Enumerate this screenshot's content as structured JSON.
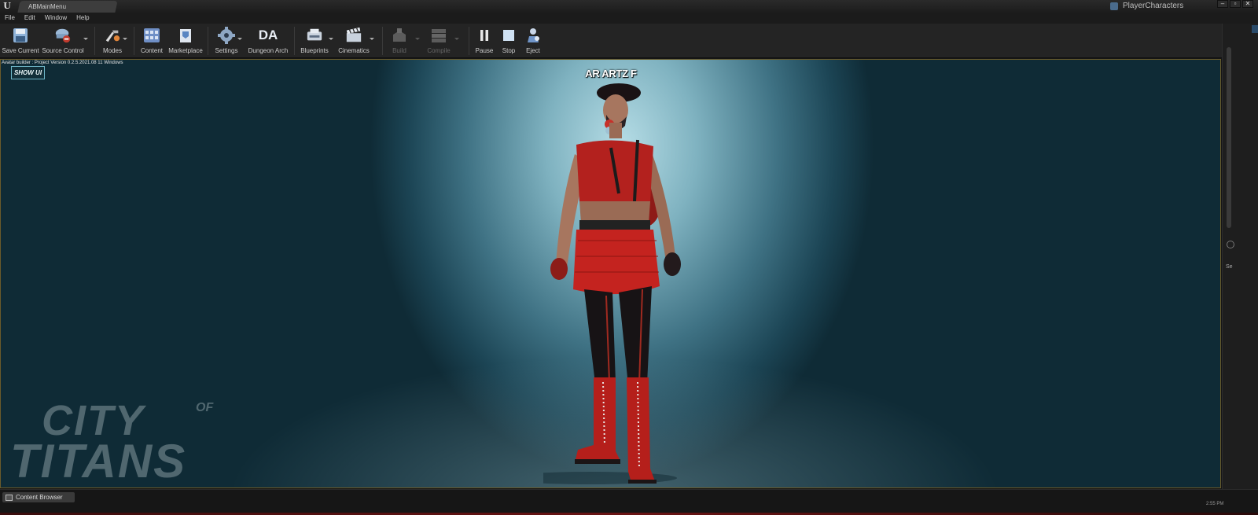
{
  "window": {
    "tab_title": "ABMainMenu",
    "project_name": "PlayerCharacters",
    "controls": [
      "–",
      "▫",
      "✕"
    ]
  },
  "menu": {
    "items": [
      "File",
      "Edit",
      "Window",
      "Help"
    ]
  },
  "toolbar": {
    "buttons": [
      {
        "label": "Save Current",
        "icon": "save-icon",
        "enabled": true
      },
      {
        "label": "Source Control",
        "icon": "source-control-icon",
        "enabled": true
      },
      {
        "label": "Modes",
        "icon": "modes-icon",
        "enabled": true
      },
      {
        "label": "Content",
        "icon": "content-icon",
        "enabled": true
      },
      {
        "label": "Marketplace",
        "icon": "marketplace-icon",
        "enabled": true
      },
      {
        "label": "Settings",
        "icon": "settings-icon",
        "enabled": true
      },
      {
        "label": "Dungeon Arch",
        "icon": "dungeon-arch-icon",
        "enabled": true
      },
      {
        "label": "Blueprints",
        "icon": "blueprints-icon",
        "enabled": true
      },
      {
        "label": "Cinematics",
        "icon": "cinematics-icon",
        "enabled": true
      },
      {
        "label": "Build",
        "icon": "build-icon",
        "enabled": false
      },
      {
        "label": "Compile",
        "icon": "compile-icon",
        "enabled": false
      },
      {
        "label": "Pause",
        "icon": "pause-icon",
        "enabled": true
      },
      {
        "label": "Stop",
        "icon": "stop-icon",
        "enabled": true
      },
      {
        "label": "Eject",
        "icon": "eject-icon",
        "enabled": true
      }
    ],
    "dungeon_arch_glyph": "DA"
  },
  "viewport": {
    "version_text": "Avatar builder : Project Version 0.2.5.2021.08 11 Windows",
    "show_ui_label": "SHOW UI",
    "character_name": "AR ARTZ F",
    "logo_line1": "CITY",
    "logo_of": "OF",
    "logo_line2": "TITANS"
  },
  "right_panel": {
    "text": "Se"
  },
  "bottom": {
    "content_browser_label": "Content Browser",
    "clock": "2:55 PM"
  },
  "colors": {
    "accent_border": "#6a5b2a",
    "outfit_red": "#b3211e",
    "show_ui_border": "#6fb7c8"
  }
}
